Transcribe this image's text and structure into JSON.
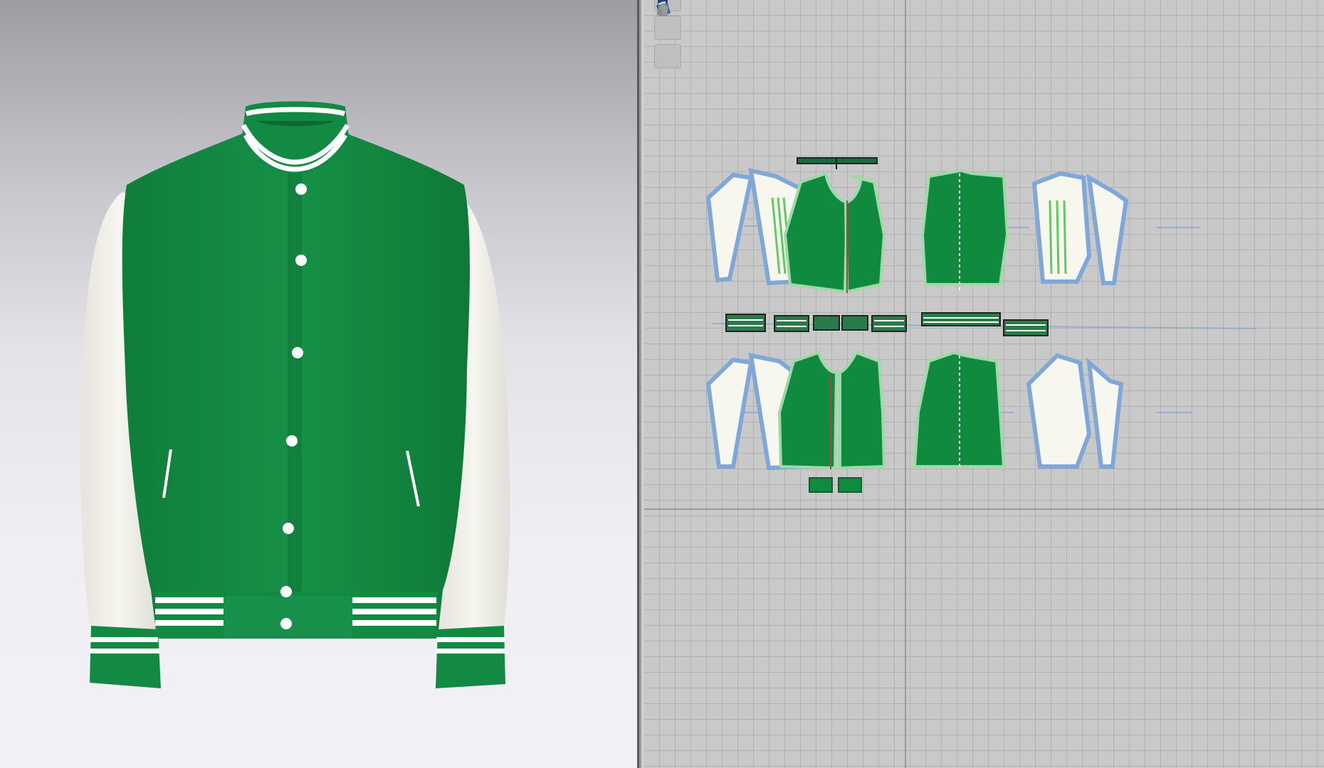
{
  "app": {
    "views": [
      {
        "id": "3d-avatar-window"
      },
      {
        "id": "2d-pattern-window"
      }
    ]
  },
  "toolbar": {
    "items": [
      {
        "icon": "avatar-display-icon",
        "state": "normal"
      },
      {
        "icon": "texture-surface-icon",
        "state": "active"
      },
      {
        "icon": "lock-garment-icon",
        "state": "disabled"
      }
    ]
  },
  "garment": {
    "type": "varsity jacket",
    "body_color": "#138a43",
    "sleeve_color": "#f3f1ea",
    "rib_stripe_color": "#ffffff",
    "button_color": "#ffffff",
    "buttons_visible": 7
  },
  "pattern": {
    "piece_fill_green": "#0f8a3e",
    "piece_fill_white": "#f7f7ef",
    "outline_color": "#7fa8d8",
    "seam_color": "#9fd9a8"
  }
}
